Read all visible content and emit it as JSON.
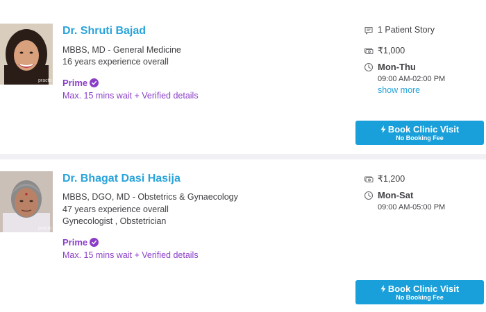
{
  "colors": {
    "name_link": "#28a3da",
    "prime": "#8a3ec8",
    "button_bg": "#199fd9",
    "text": "#414146"
  },
  "doctors": [
    {
      "name": "Dr. Shruti Bajad",
      "qualification": "MBBS, MD - General Medicine",
      "experience": "16 years experience overall",
      "prime_label": "Prime",
      "wait_info": "Max. 15 mins wait + Verified details",
      "patient_stories": "1 Patient Story",
      "fee": "₹1,000",
      "days": "Mon-Thu",
      "hours": "09:00 AM-02:00 PM",
      "show_more": "show more",
      "book_label": "Book Clinic Visit",
      "book_sub": "No Booking Fee",
      "photo_watermark": "practo"
    },
    {
      "name": "Dr. Bhagat Dasi Hasija",
      "qualification": "MBBS, DGO, MD - Obstetrics & Gynaecology",
      "experience": "47 years experience overall",
      "specialty": "Gynecologist , Obstetrician",
      "prime_label": "Prime",
      "wait_info": "Max. 15 mins wait + Verified details",
      "fee": "₹1,200",
      "days": "Mon-Sat",
      "hours": "09:00 AM-05:00 PM",
      "book_label": "Book Clinic Visit",
      "book_sub": "No Booking Fee",
      "photo_watermark": "practo"
    }
  ],
  "icons": {
    "stories": "chat-bubble-icon",
    "fee": "money-icon",
    "timing": "clock-icon",
    "prime": "verified-check-icon",
    "book": "lightning-bolt-icon"
  }
}
